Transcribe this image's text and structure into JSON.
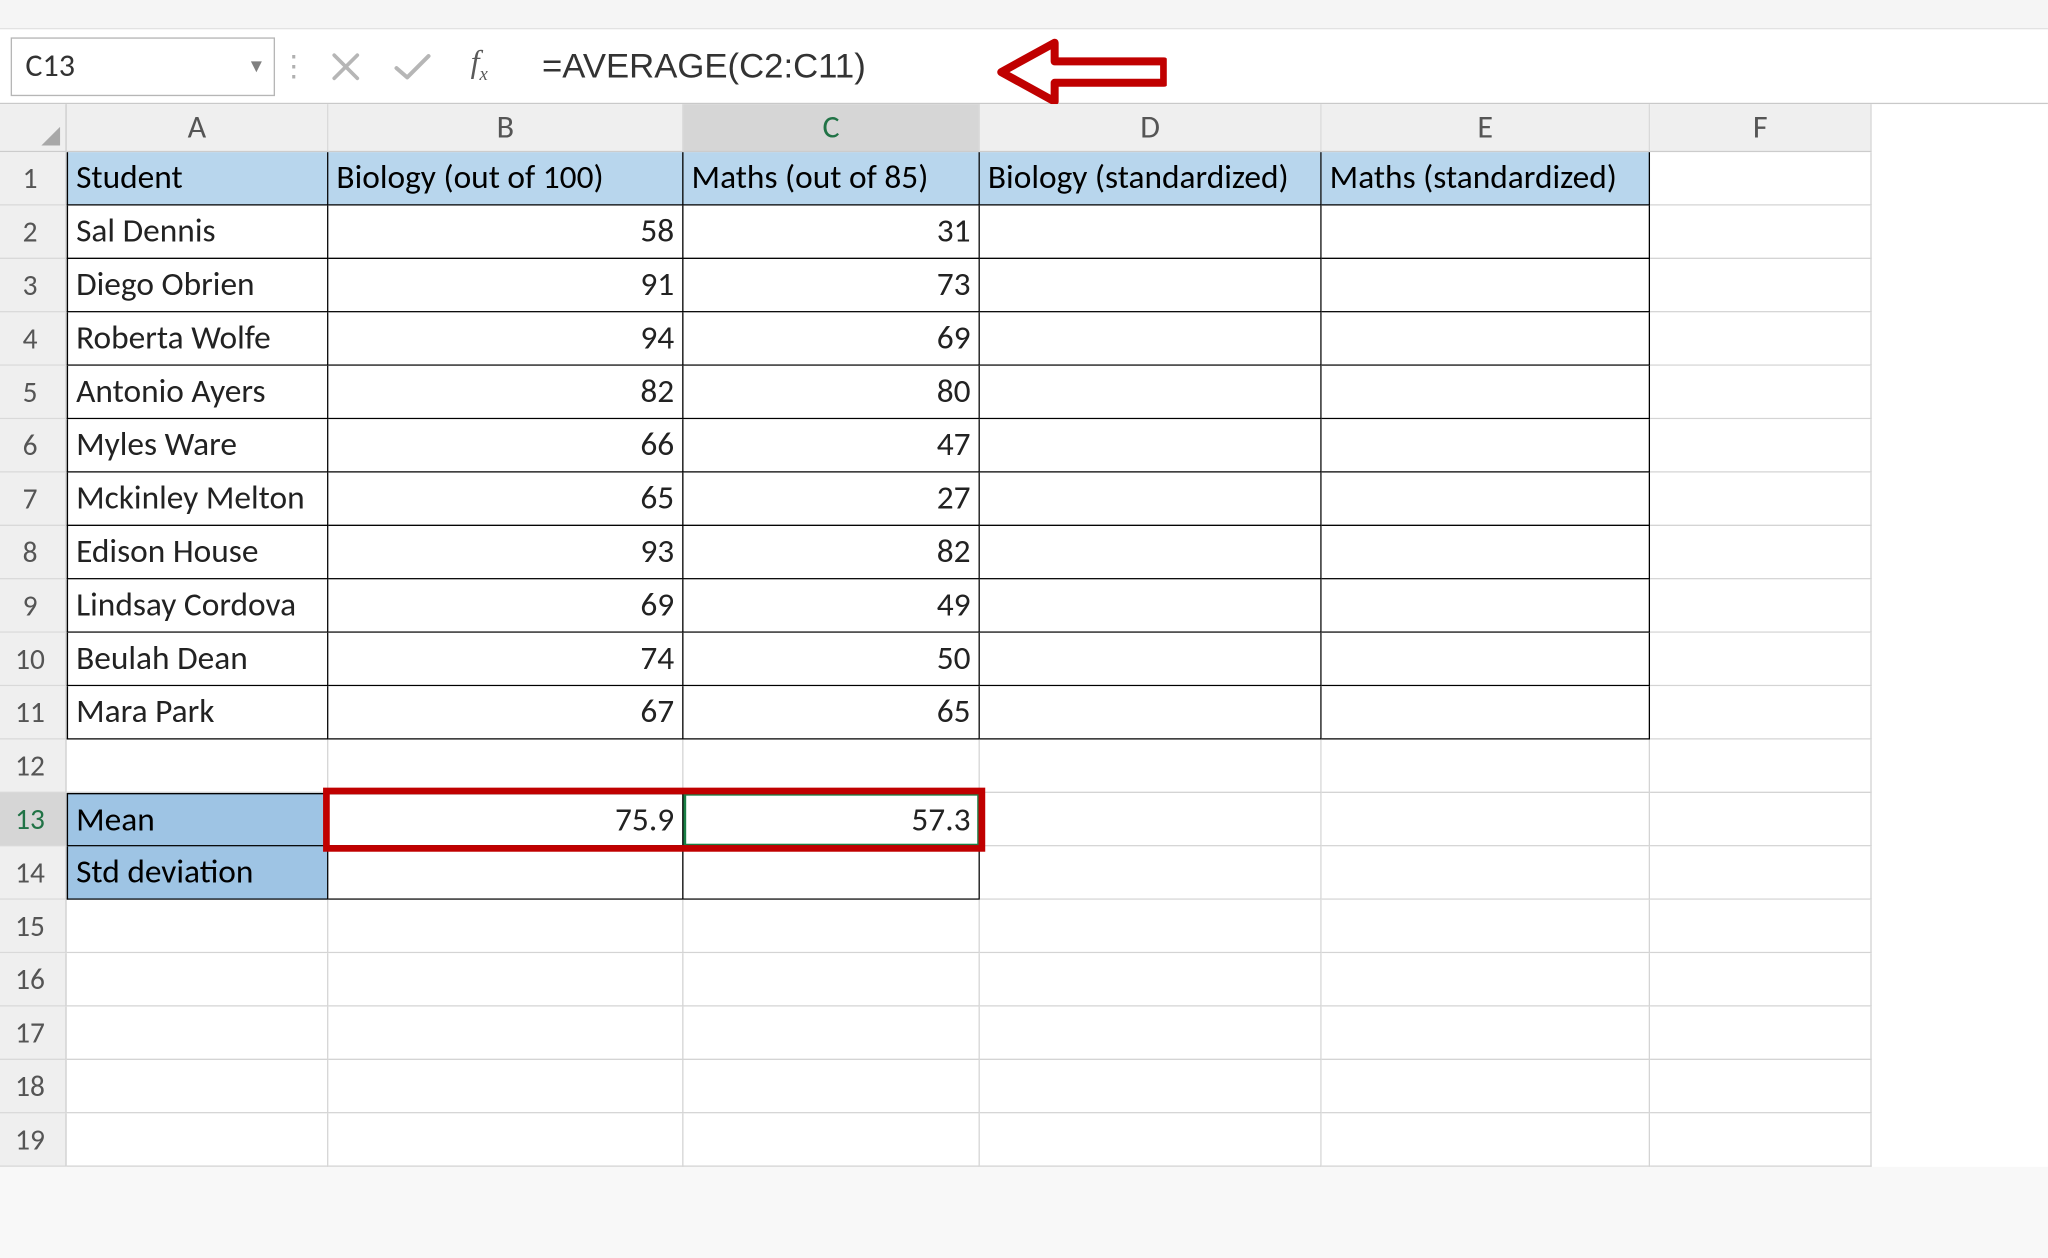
{
  "namebox": "C13",
  "formula": "=AVERAGE(C2:C11)",
  "columns": [
    "A",
    "B",
    "C",
    "D",
    "E",
    "F"
  ],
  "headers": {
    "A": "Student",
    "B": "Biology (out of 100)",
    "C": "Maths (out of 85)",
    "D": "Biology (standardized)",
    "E": "Maths (standardized)"
  },
  "rows": [
    {
      "n": 1
    },
    {
      "n": 2,
      "A": "Sal Dennis",
      "B": "58",
      "C": "31"
    },
    {
      "n": 3,
      "A": "Diego Obrien",
      "B": "91",
      "C": "73"
    },
    {
      "n": 4,
      "A": "Roberta Wolfe",
      "B": "94",
      "C": "69"
    },
    {
      "n": 5,
      "A": "Antonio Ayers",
      "B": "82",
      "C": "80"
    },
    {
      "n": 6,
      "A": "Myles Ware",
      "B": "66",
      "C": "47"
    },
    {
      "n": 7,
      "A": "Mckinley Melton",
      "B": "65",
      "C": "27"
    },
    {
      "n": 8,
      "A": "Edison House",
      "B": "93",
      "C": "82"
    },
    {
      "n": 9,
      "A": "Lindsay Cordova",
      "B": "69",
      "C": "49"
    },
    {
      "n": 10,
      "A": "Beulah Dean",
      "B": "74",
      "C": "50"
    },
    {
      "n": 11,
      "A": "Mara Park",
      "B": "67",
      "C": "65"
    },
    {
      "n": 12
    },
    {
      "n": 13,
      "A": "Mean",
      "B": "75.9",
      "C": "57.3",
      "label": true
    },
    {
      "n": 14,
      "A": "Std deviation",
      "label": true
    },
    {
      "n": 15
    },
    {
      "n": 16
    },
    {
      "n": 17
    },
    {
      "n": 18
    },
    {
      "n": 19
    }
  ],
  "active_cell": "C13",
  "chart_data": {
    "type": "table",
    "title": "Student scores",
    "columns": [
      "Student",
      "Biology (out of 100)",
      "Maths (out of 85)"
    ],
    "rows": [
      [
        "Sal Dennis",
        58,
        31
      ],
      [
        "Diego Obrien",
        91,
        73
      ],
      [
        "Roberta Wolfe",
        94,
        69
      ],
      [
        "Antonio Ayers",
        82,
        80
      ],
      [
        "Myles Ware",
        66,
        47
      ],
      [
        "Mckinley Melton",
        65,
        27
      ],
      [
        "Edison House",
        93,
        82
      ],
      [
        "Lindsay Cordova",
        69,
        49
      ],
      [
        "Beulah Dean",
        74,
        50
      ],
      [
        "Mara Park",
        67,
        65
      ]
    ],
    "summary": {
      "Mean": {
        "Biology": 75.9,
        "Maths": 57.3
      }
    }
  }
}
